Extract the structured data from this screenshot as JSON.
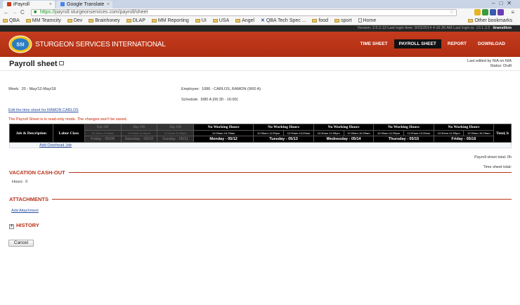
{
  "browser": {
    "tabs": [
      {
        "label": "iPayroll",
        "active": true
      },
      {
        "label": "Google Translate",
        "active": false
      }
    ],
    "url_protocol": "https://",
    "url_rest": "payroll.sturgeonservices.com/payroll/sheet",
    "bookmarks": [
      "QBA",
      "MM Teamcity",
      "Dev",
      "Brainhoney",
      "DLAP",
      "MM Reporting",
      "UI",
      "USA",
      "Angel",
      "QBA Tech Spec ...",
      "food",
      "sport",
      "Home"
    ],
    "other_bookmarks": "Other bookmarks"
  },
  "app": {
    "status_text": "Version: 2.5.2.13     Last login time: 9/23/2014 4:16:30 AM     Last login ip: 10.1.3.5",
    "user": "itransition",
    "brand": "STURGEON SERVICES INTERNATIONAL",
    "logo_text": "SSI",
    "nav": [
      "TIME SHEET",
      "PAYROLL SHEET",
      "REPORT",
      "DOWNLOAD"
    ]
  },
  "page": {
    "title": "Payroll sheet",
    "last_edited": "Last edited by N/A   on N/A",
    "status": "Status: Draft",
    "week_label": "Week:",
    "week_value": "20 - May/12-May/18",
    "employee_label": "Employee:",
    "employee_value": "1086 - CARLOS, RAMON (9/60 A)",
    "schedule_label": "Schedule:",
    "schedule_value": "9/80 A (06:30 - 16:00)",
    "edit_link": "Edit the time sheet for RAMON CARLOS",
    "readonly_warning": "The Payroll Sheet is in read-only mode. The changes won't be saved.",
    "payroll_total": "Payroll sheet total: 0h",
    "timesheet_total": "Time sheet total:",
    "vacation_title": "VACATION CASH-OUT",
    "hours_label": "Hours:",
    "hours_value": "0",
    "attachments_title": "ATTACHMENTS",
    "add_attachment": "Add Attachment",
    "history_title": "HISTORY",
    "cancel_label": "Cancel"
  },
  "grid": {
    "job_header": "Job & Description",
    "labor_header": "Labor Class",
    "total_header": "Total, h",
    "add_overhead": "Add Overhead Job",
    "days": [
      {
        "status": "Day Off",
        "times": [
          "10:30am-11:59pm"
        ],
        "label": "Friday - 05/09",
        "off": true
      },
      {
        "status": "Day Off",
        "times": [
          "12:00am-11:59pm"
        ],
        "label": "Saturday - 05/10",
        "off": true
      },
      {
        "status": "Day Off",
        "times": [
          "12:00am-11:59pm"
        ],
        "label": "Sunday - 05/11",
        "off": true
      },
      {
        "status": "No Working Hours",
        "times": [
          "12:00am-10:29am"
        ],
        "label": "Monday - 05/12",
        "off": false
      },
      {
        "status": "No Working Hours",
        "times": [
          "10:30am-11:59pm",
          "12:00am-10:29am"
        ],
        "label": "Tuesday - 05/13",
        "off": false
      },
      {
        "status": "No Working Hours",
        "times": [
          "10:30am-11:59pm",
          "12:00am-10:29am"
        ],
        "label": "Wednesday - 05/14",
        "off": false
      },
      {
        "status": "No Working Hours",
        "times": [
          "10:30am-11:59pm",
          "12:00am-10:29am"
        ],
        "label": "Thursday - 05/15",
        "off": false
      },
      {
        "status": "No Working Hours",
        "times": [
          "10:30am-11:59pm",
          "12:00am-10:29am"
        ],
        "label": "Friday - 05/16",
        "off": false
      }
    ]
  }
}
